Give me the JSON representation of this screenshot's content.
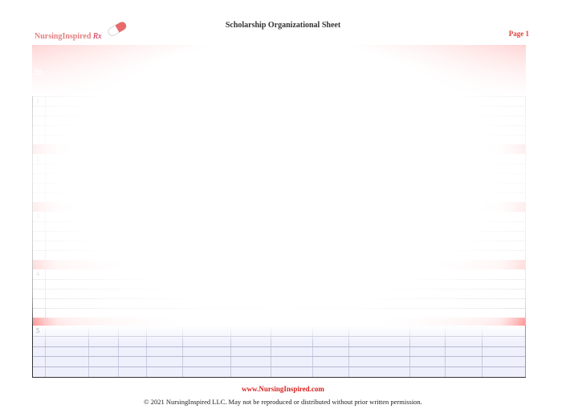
{
  "document": {
    "title": "Scholarship Organizational Sheet",
    "brand": {
      "name": "NursingInspired",
      "suffix": "Rx"
    },
    "page_label": "Page 1"
  },
  "table": {
    "number_header": "No.",
    "rows": [
      "1",
      "2",
      "3",
      "4",
      "5"
    ]
  },
  "footer": {
    "url": "www.NursingInspired.com",
    "copyright": "© 2021 NursingInspired LLC. May not be reproduced or distributed without prior written permission."
  },
  "colors": {
    "accent": "#e0413b",
    "header_band": "#ff9a9a",
    "row5_fill": "#eef0fc"
  }
}
